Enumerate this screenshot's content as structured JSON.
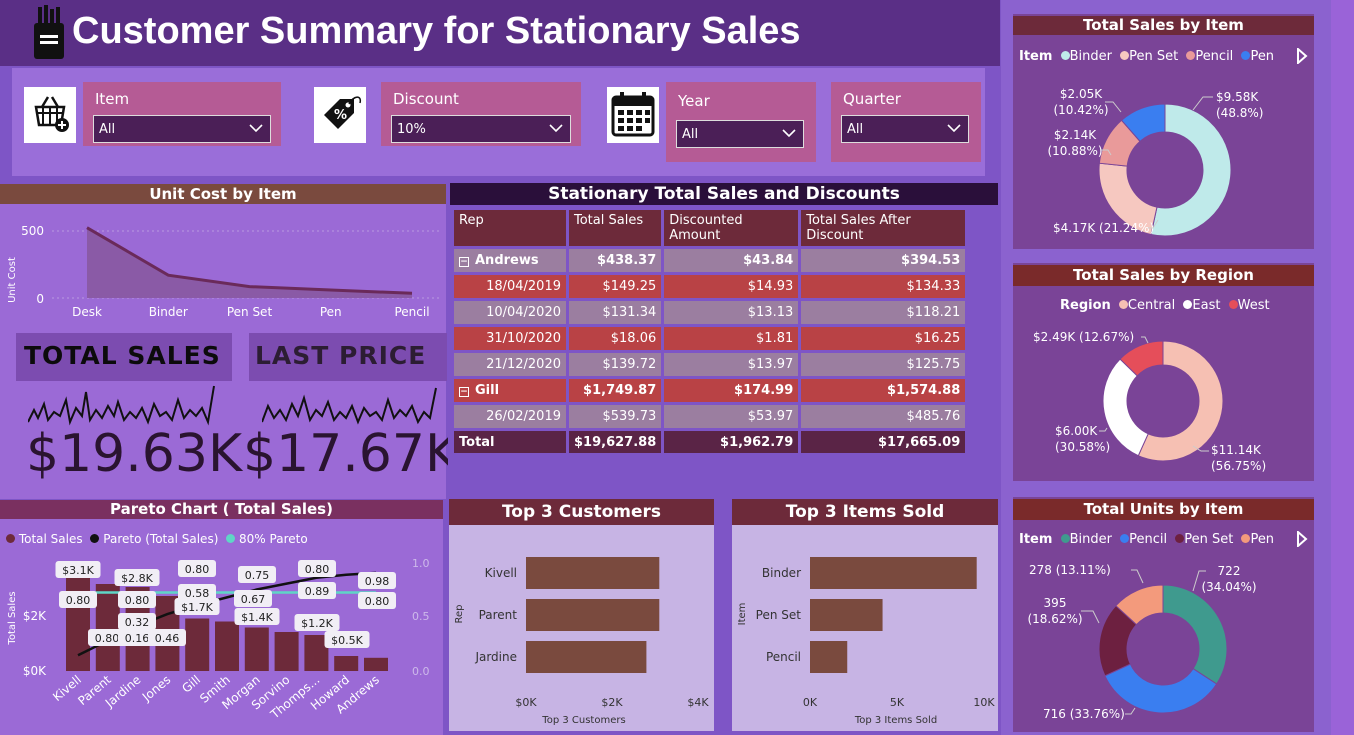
{
  "header": {
    "title": "Customer Summary for Stationary Sales"
  },
  "filters": [
    {
      "label": "Item",
      "value": "All",
      "icon": "basket-add-icon"
    },
    {
      "label": "Discount",
      "value": "10%",
      "icon": "price-tag-icon"
    },
    {
      "label": "Year",
      "value": "All",
      "icon": "calendar-icon"
    },
    {
      "label": "Quarter",
      "value": "All"
    }
  ],
  "unit_cost": {
    "title": "Unit Cost by Item",
    "ylabel": "Unit Cost",
    "y_ticks": [
      "500",
      "0"
    ],
    "chart_data": {
      "type": "area",
      "categories": [
        "Desk",
        "Binder",
        "Pen Set",
        "Pen",
        "Pencil"
      ],
      "values": [
        525,
        170,
        85,
        60,
        35
      ],
      "ylim": [
        0,
        600
      ]
    }
  },
  "kpis": {
    "total_sales_label": "TOTAL SALES",
    "total_sales_value": "$19.63K",
    "last_price_label": "LAST PRICE",
    "last_price_value": "$17.67K"
  },
  "sales_table": {
    "title": "Stationary Total Sales and Discounts",
    "columns": [
      "Rep",
      "Total Sales",
      "Discounted Amount",
      "Total Sales After Discount"
    ],
    "rows": [
      {
        "rep": "Andrews",
        "group": true,
        "total": "$438.37",
        "disc": "$43.84",
        "after": "$394.53"
      },
      {
        "rep": "18/04/2019",
        "total": "$149.25",
        "disc": "$14.93",
        "after": "$134.33"
      },
      {
        "rep": "10/04/2020",
        "total": "$131.34",
        "disc": "$13.13",
        "after": "$118.21"
      },
      {
        "rep": "31/10/2020",
        "total": "$18.06",
        "disc": "$1.81",
        "after": "$16.25"
      },
      {
        "rep": "21/12/2020",
        "total": "$139.72",
        "disc": "$13.97",
        "after": "$125.75"
      },
      {
        "rep": "Gill",
        "group": true,
        "total": "$1,749.87",
        "disc": "$174.99",
        "after": "$1,574.88"
      },
      {
        "rep": "26/02/2019",
        "total": "$539.73",
        "disc": "$53.97",
        "after": "$485.76"
      }
    ],
    "total_row": {
      "label": "Total",
      "total": "$19,627.88",
      "disc": "$1,962.79",
      "after": "$17,665.09"
    }
  },
  "pareto": {
    "title": "Pareto Chart ( Total Sales)",
    "legend": [
      "Total Sales",
      "Pareto (Total Sales)",
      "80% Pareto"
    ],
    "ylabel": "Total Sales",
    "y_ticks_left": [
      "$2K",
      "$0K"
    ],
    "y_ticks_right": [
      "1.0",
      "0.5",
      "0.0"
    ],
    "data_labels": [
      "$3.1K",
      "0.80",
      "$2.8K",
      "0.80",
      "0.80",
      "0.32",
      "0.16",
      "0.46",
      "0.80",
      "0.58",
      "$1.7K",
      "0.75",
      "0.67",
      "$1.4K",
      "0.80",
      "0.89",
      "$1.2K",
      "0.98",
      "0.80",
      "$0.5K"
    ],
    "chart_data": {
      "type": "bar",
      "categories": [
        "Kivell",
        "Parent",
        "Jardine",
        "Jones",
        "Gill",
        "Smith",
        "Morgan",
        "Sorvino",
        "Thomps...",
        "Howard",
        "Andrews"
      ],
      "series": [
        {
          "name": "Total Sales",
          "values": [
            3100,
            2900,
            2800,
            2500,
            1750,
            1650,
            1450,
            1300,
            1200,
            500,
            440
          ]
        },
        {
          "name": "Pareto (Total Sales)",
          "values": [
            0.16,
            0.31,
            0.46,
            0.58,
            0.67,
            0.75,
            0.83,
            0.89,
            0.95,
            0.98,
            1.0
          ]
        },
        {
          "name": "80% Pareto",
          "values": [
            0.8,
            0.8,
            0.8,
            0.8,
            0.8,
            0.8,
            0.8,
            0.8,
            0.8,
            0.8,
            0.8
          ]
        }
      ],
      "ylim": [
        0,
        3500
      ],
      "y2lim": [
        0,
        1.1
      ]
    }
  },
  "top_customers": {
    "title": "Top 3 Customers",
    "ylabel": "Rep",
    "xlabel": "Top 3 Customers",
    "x_ticks": [
      "$0K",
      "$2K",
      "$4K"
    ],
    "chart_data": {
      "type": "bar",
      "categories": [
        "Kivell",
        "Parent",
        "Jardine"
      ],
      "values": [
        3100,
        3100,
        2800
      ],
      "xlim": [
        0,
        4000
      ]
    }
  },
  "top_items": {
    "title": "Top 3 Items Sold",
    "ylabel": "Item",
    "xlabel": "Top 3 Items Sold",
    "x_ticks": [
      "0K",
      "5K",
      "10K"
    ],
    "chart_data": {
      "type": "bar",
      "categories": [
        "Binder",
        "Pen Set",
        "Pencil"
      ],
      "values": [
        9580,
        4170,
        2140
      ],
      "xlim": [
        0,
        10000
      ]
    }
  },
  "sales_by_item": {
    "title": "Total Sales by Item",
    "legend_title": "Item",
    "labels": [
      "$9.58K\n(48.8%)",
      "$4.17K (21.24%)",
      "$2.14K\n(10.88%)",
      "$2.05K\n(10.42%)"
    ],
    "chart_data": {
      "type": "pie",
      "categories": [
        "Binder",
        "Pen Set",
        "Pencil",
        "Pen"
      ],
      "values": [
        9580,
        4170,
        2140,
        2050
      ],
      "colors": [
        "#bfeaea",
        "#f6c8c0",
        "#e99a9a",
        "#3a7ef0"
      ]
    },
    "extra_slice_color": "#e54e5a"
  },
  "sales_by_region": {
    "title": "Total Sales by Region",
    "legend_title": "Region",
    "labels": [
      "$11.14K\n(56.75%)",
      "$6.00K\n(30.58%)",
      "$2.49K (12.67%)"
    ],
    "chart_data": {
      "type": "pie",
      "categories": [
        "Central",
        "East",
        "West"
      ],
      "values": [
        11140,
        6000,
        2490
      ],
      "colors": [
        "#f6c0b3",
        "#ffffff",
        "#e54e5a"
      ]
    }
  },
  "units_by_item": {
    "title": "Total Units by Item",
    "legend_title": "Item",
    "labels": [
      "722\n(34.04%)",
      "716 (33.76%)",
      "395\n(18.62%)",
      "278 (13.11%)"
    ],
    "chart_data": {
      "type": "pie",
      "categories": [
        "Binder",
        "Pencil",
        "Pen Set",
        "Pen"
      ],
      "values": [
        722,
        716,
        395,
        278
      ],
      "colors": [
        "#3f9a8e",
        "#3a7ef0",
        "#6d2040",
        "#f39a7c"
      ]
    }
  }
}
